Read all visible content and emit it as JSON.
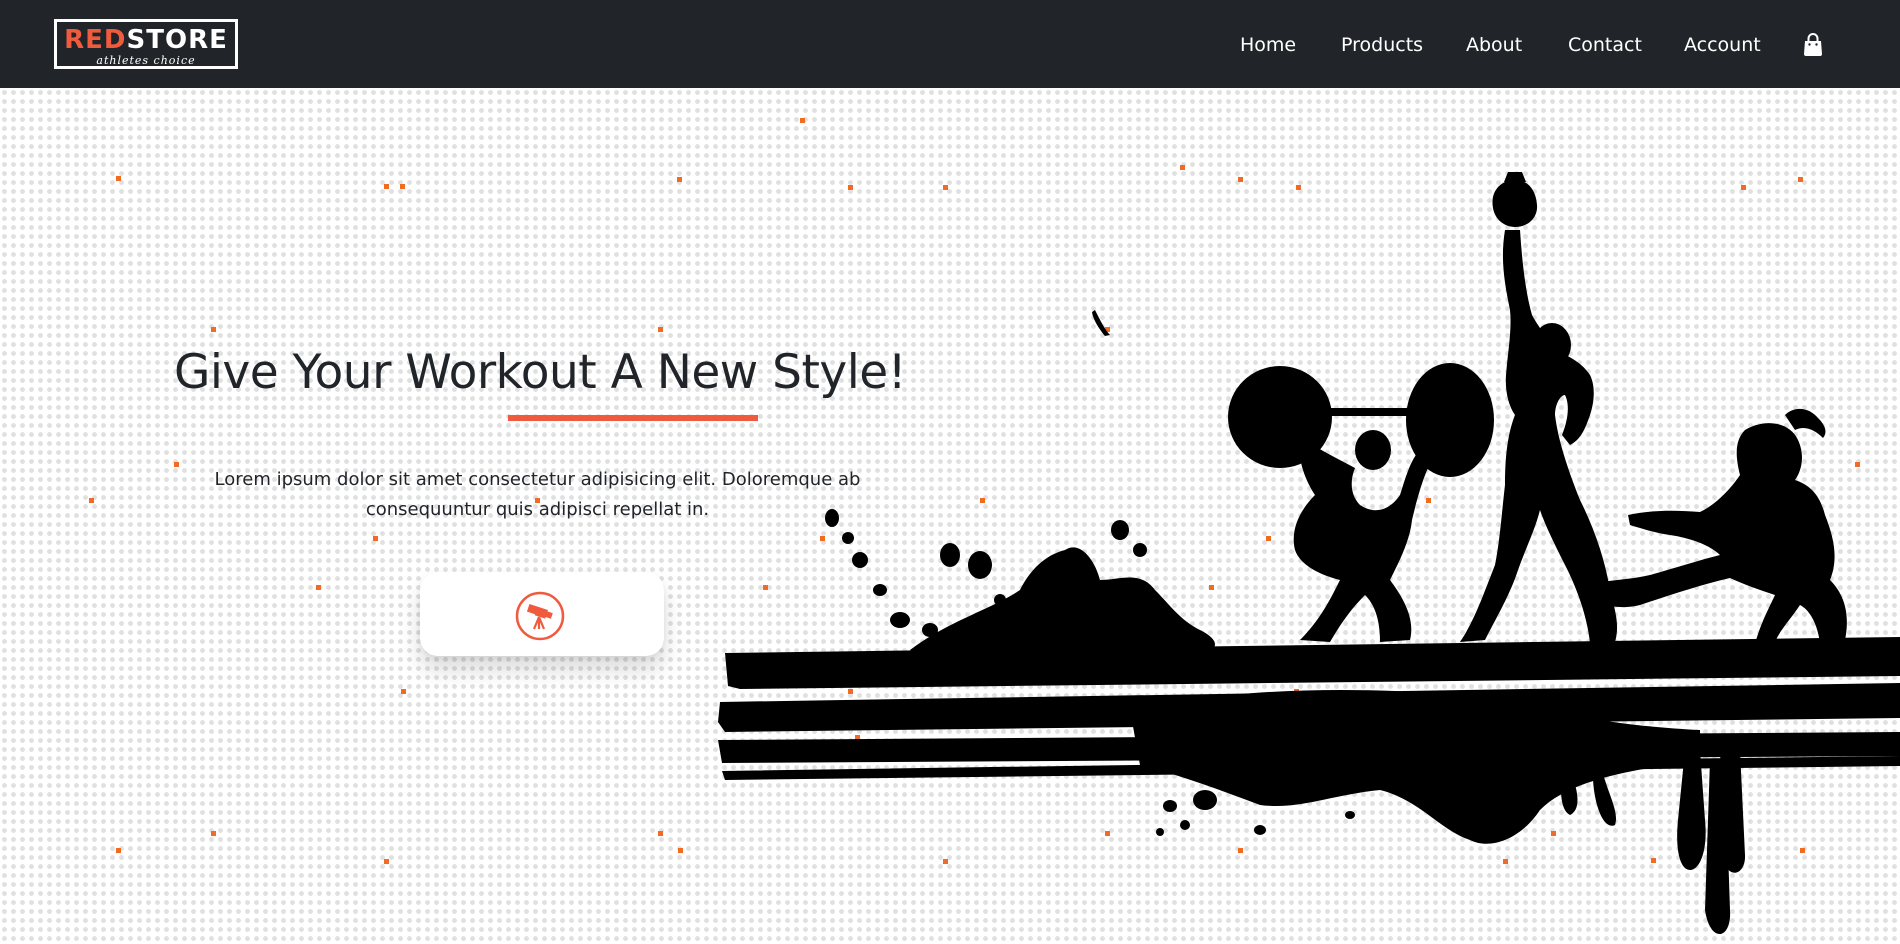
{
  "brand": {
    "logo_left": "RE",
    "logo_d": "D",
    "logo_right": "STORE",
    "tagline": "athletes choice",
    "accent_color": "#f05a3d"
  },
  "nav": {
    "items": [
      {
        "label": "Home"
      },
      {
        "label": "Products"
      },
      {
        "label": "About"
      },
      {
        "label": "Contact"
      },
      {
        "label": "Account"
      }
    ],
    "cart_icon": "shopping-bag-icon",
    "background": "#212529"
  },
  "hero": {
    "title": "Give Your Workout A New Style!",
    "description": "Lorem ipsum dolor sit amet consectetur adipisicing elit. Doloremque ab consequuntur quis adipisci repellat in.",
    "button_icon": "telescope-icon",
    "illustration": "fitness-athletes-silhouette"
  }
}
